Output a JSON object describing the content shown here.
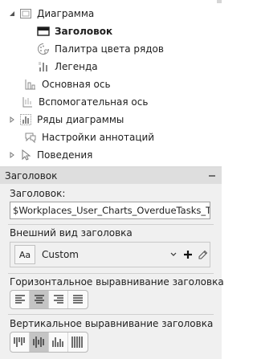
{
  "tree": {
    "items": [
      {
        "label": "Диаграмма",
        "icon": "chart-frame-icon",
        "expanded": true
      },
      {
        "label": "Заголовок",
        "icon": "title-icon",
        "selected": true
      },
      {
        "label": "Палитра цвета рядов",
        "icon": "palette-icon"
      },
      {
        "label": "Легенда",
        "icon": "legend-icon"
      },
      {
        "label": "Основная ось",
        "icon": "primary-axis-icon"
      },
      {
        "label": "Вспомогательная ось",
        "icon": "secondary-axis-icon"
      },
      {
        "label": "Ряды диаграммы",
        "icon": "chart-series-icon",
        "collapsed": true
      },
      {
        "label": "Настройки аннотаций",
        "icon": "annotations-icon"
      },
      {
        "label": "Поведения",
        "icon": "behaviors-icon",
        "collapsed": true
      }
    ]
  },
  "panel": {
    "section_title": "Заголовок",
    "title_label": "Заголовок:",
    "title_value": "$Workplaces_User_Charts_OverdueTasks_Title",
    "appearance_label": "Внешний вид заголовка",
    "style_swatch": "Aa",
    "style_name": "Custom",
    "h_align_label": "Горизонтальное выравнивание заголовка",
    "h_align_selected": "center",
    "v_align_label": "Вертикальное выравнивание заголовка",
    "v_align_selected": "middle"
  },
  "colors": {
    "selected_button": "#c4c4c4",
    "panel_bg": "#f0f0f0",
    "section_header_bg": "#dedede"
  }
}
